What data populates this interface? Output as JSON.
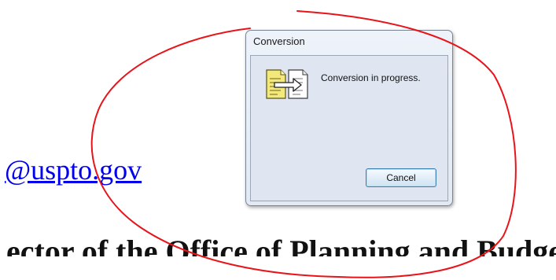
{
  "document": {
    "link_text": "@uspto.gov",
    "body_text": "ector of the Office of Planning and Budget"
  },
  "dialog": {
    "title": "Conversion",
    "message": "Conversion in progress.",
    "cancel_label": "Cancel",
    "icon": "document-conversion-icon"
  },
  "annotation": {
    "color": "#e8141a"
  }
}
